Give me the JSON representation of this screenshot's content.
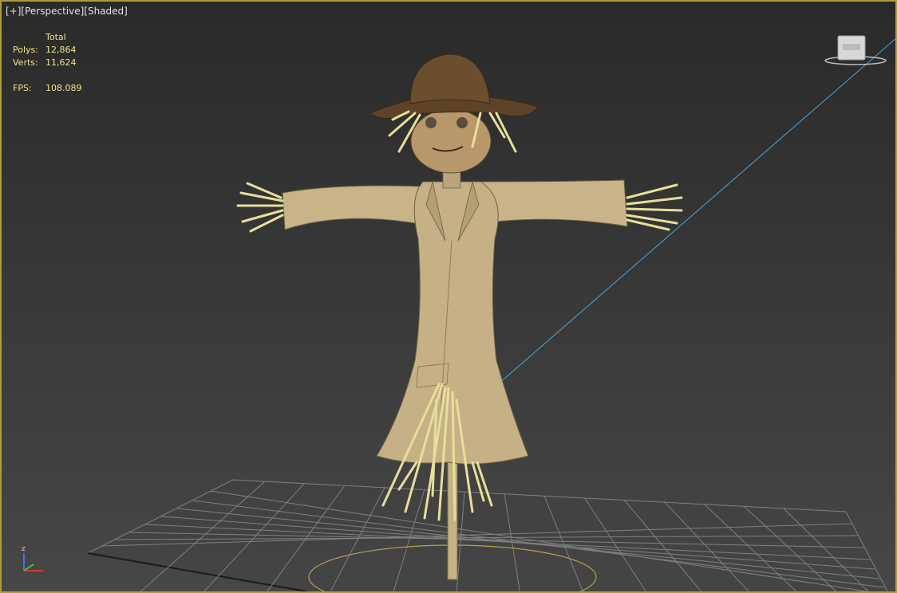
{
  "viewport": {
    "label": {
      "plus": "[+]",
      "view": "[Perspective]",
      "shading": "[Shaded]"
    },
    "stats": {
      "header": "Total",
      "polys_label": "Polys:",
      "polys_value": "12,864",
      "verts_label": "Verts:",
      "verts_value": "11,624",
      "fps_label": "FPS:",
      "fps_value": "108.089"
    },
    "axis_tripod": {
      "z_label": "z"
    },
    "colors": {
      "border": "#b39a3a",
      "stats_text": "#f0e08a",
      "grid": "#8a8a8a",
      "burlap": "#c9b48a",
      "hat": "#6b4e2e",
      "straw": "#e6df9a",
      "light_line": "#4aa3d8",
      "selection_circle": "#b8a24a"
    },
    "icons": [
      "viewcube-icon",
      "axis-tripod-icon"
    ]
  }
}
